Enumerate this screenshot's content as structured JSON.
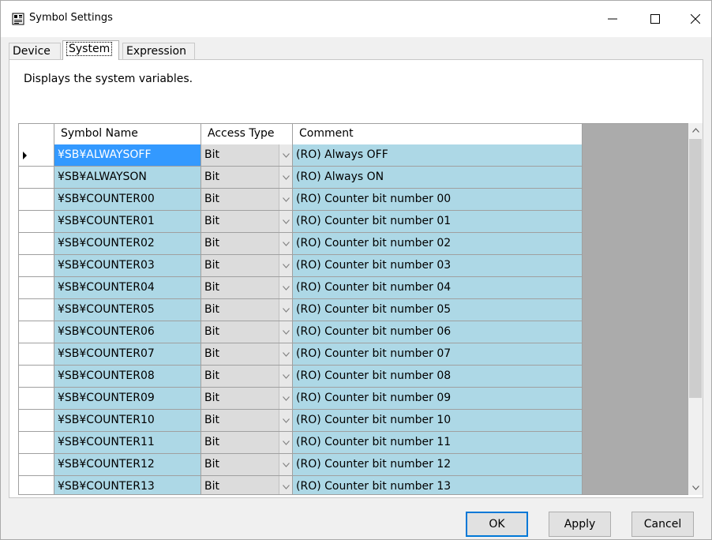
{
  "window": {
    "title": "Symbol Settings",
    "minimize_glyph": "—",
    "maximize_glyph": "☐",
    "close_glyph": "✕"
  },
  "tabs": [
    {
      "label": "Device"
    },
    {
      "label": "System",
      "selected": true
    },
    {
      "label": "Expression"
    }
  ],
  "description": "Displays the system variables.",
  "grid": {
    "columns": [
      "Symbol Name",
      "Access Type",
      "Comment"
    ],
    "rows": [
      {
        "name": "¥SB¥ALWAYSOFF",
        "type": "Bit",
        "comment": "(RO) Always OFF"
      },
      {
        "name": "¥SB¥ALWAYSON",
        "type": "Bit",
        "comment": "(RO) Always ON"
      },
      {
        "name": "¥SB¥COUNTER00",
        "type": "Bit",
        "comment": "(RO) Counter bit number 00"
      },
      {
        "name": "¥SB¥COUNTER01",
        "type": "Bit",
        "comment": "(RO) Counter bit number 01"
      },
      {
        "name": "¥SB¥COUNTER02",
        "type": "Bit",
        "comment": "(RO) Counter bit number 02"
      },
      {
        "name": "¥SB¥COUNTER03",
        "type": "Bit",
        "comment": "(RO) Counter bit number 03"
      },
      {
        "name": "¥SB¥COUNTER04",
        "type": "Bit",
        "comment": "(RO) Counter bit number 04"
      },
      {
        "name": "¥SB¥COUNTER05",
        "type": "Bit",
        "comment": "(RO) Counter bit number 05"
      },
      {
        "name": "¥SB¥COUNTER06",
        "type": "Bit",
        "comment": "(RO) Counter bit number 06"
      },
      {
        "name": "¥SB¥COUNTER07",
        "type": "Bit",
        "comment": "(RO) Counter bit number 07"
      },
      {
        "name": "¥SB¥COUNTER08",
        "type": "Bit",
        "comment": "(RO) Counter bit number 08"
      },
      {
        "name": "¥SB¥COUNTER09",
        "type": "Bit",
        "comment": "(RO) Counter bit number 09"
      },
      {
        "name": "¥SB¥COUNTER10",
        "type": "Bit",
        "comment": "(RO) Counter bit number 10"
      },
      {
        "name": "¥SB¥COUNTER11",
        "type": "Bit",
        "comment": "(RO) Counter bit number 11"
      },
      {
        "name": "¥SB¥COUNTER12",
        "type": "Bit",
        "comment": "(RO) Counter bit number 12"
      },
      {
        "name": "¥SB¥COUNTER13",
        "type": "Bit",
        "comment": "(RO) Counter bit number 13"
      }
    ]
  },
  "buttons": {
    "ok": "OK",
    "apply": "Apply",
    "cancel": "Cancel"
  },
  "colors": {
    "row_bg": "#add8e6",
    "selected_bg": "#3399ff",
    "grid_empty": "#ababab",
    "focus_border": "#0078d7"
  }
}
